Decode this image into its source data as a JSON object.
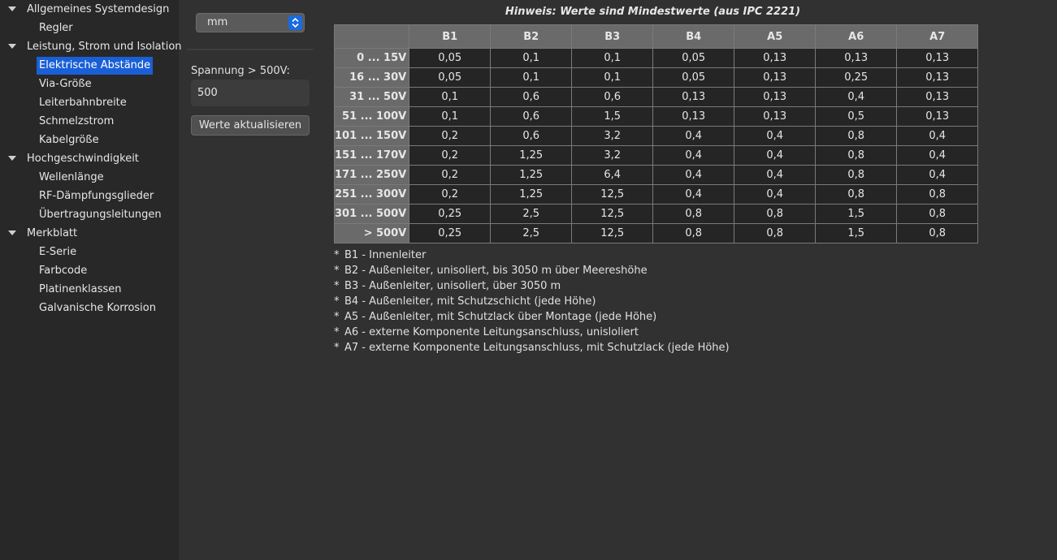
{
  "sidebar": {
    "groups": [
      {
        "label": "Allgemeines Systemdesign",
        "items": [
          "Regler"
        ]
      },
      {
        "label": "Leistung, Strom und Isolation",
        "items": [
          "Elektrische Abstände",
          "Via-Größe",
          "Leiterbahnbreite",
          "Schmelzstrom",
          "Kabelgröße"
        ]
      },
      {
        "label": "Hochgeschwindigkeit",
        "items": [
          "Wellenlänge",
          "RF-Dämpfungsglieder",
          "Übertragungsleitungen"
        ]
      },
      {
        "label": "Merkblatt",
        "items": [
          "E-Serie",
          "Farbcode",
          "Platinenklassen",
          "Galvanische Korrosion"
        ]
      }
    ],
    "selected": "Elektrische Abstände"
  },
  "controls": {
    "unit_value": "mm",
    "voltage_label": "Spannung > 500V:",
    "voltage_value": "500",
    "update_label": "Werte aktualisieren"
  },
  "main": {
    "hint": "Hinweis: Werte sind Mindestwerte (aus IPC 2221)",
    "table": {
      "columns": [
        "B1",
        "B2",
        "B3",
        "B4",
        "A5",
        "A6",
        "A7"
      ],
      "rows": [
        {
          "label": "0 ... 15V",
          "values": [
            "0,05",
            "0,1",
            "0,1",
            "0,05",
            "0,13",
            "0,13",
            "0,13"
          ]
        },
        {
          "label": "16 ... 30V",
          "values": [
            "0,05",
            "0,1",
            "0,1",
            "0,05",
            "0,13",
            "0,25",
            "0,13"
          ]
        },
        {
          "label": "31 ... 50V",
          "values": [
            "0,1",
            "0,6",
            "0,6",
            "0,13",
            "0,13",
            "0,4",
            "0,13"
          ]
        },
        {
          "label": "51 ... 100V",
          "values": [
            "0,1",
            "0,6",
            "1,5",
            "0,13",
            "0,13",
            "0,5",
            "0,13"
          ]
        },
        {
          "label": "101 ... 150V",
          "values": [
            "0,2",
            "0,6",
            "3,2",
            "0,4",
            "0,4",
            "0,8",
            "0,4"
          ]
        },
        {
          "label": "151 ... 170V",
          "values": [
            "0,2",
            "1,25",
            "3,2",
            "0,4",
            "0,4",
            "0,8",
            "0,4"
          ]
        },
        {
          "label": "171 ... 250V",
          "values": [
            "0,2",
            "1,25",
            "6,4",
            "0,4",
            "0,4",
            "0,8",
            "0,4"
          ]
        },
        {
          "label": "251 ... 300V",
          "values": [
            "0,2",
            "1,25",
            "12,5",
            "0,4",
            "0,4",
            "0,8",
            "0,8"
          ]
        },
        {
          "label": "301 ... 500V",
          "values": [
            "0,25",
            "2,5",
            "12,5",
            "0,8",
            "0,8",
            "1,5",
            "0,8"
          ]
        },
        {
          "label": "> 500V",
          "values": [
            "0,25",
            "2,5",
            "12,5",
            "0,8",
            "0,8",
            "1,5",
            "0,8"
          ]
        }
      ]
    },
    "legend": [
      "B1 - Innenleiter",
      "B2 - Außenleiter, unisoliert, bis 3050 m über Meereshöhe",
      "B3 - Außenleiter, unisoliert, über 3050 m",
      "B4 - Außenleiter, mit Schutzschicht (jede Höhe)",
      "A5 - Außenleiter, mit Schutzlack über Montage (jede Höhe)",
      "A6 - externe Komponente Leitungsanschluss, unisloliert",
      "A7 - externe Komponente Leitungsanschluss, mit Schutzlack (jede Höhe)"
    ],
    "legend_bullet": "*"
  }
}
